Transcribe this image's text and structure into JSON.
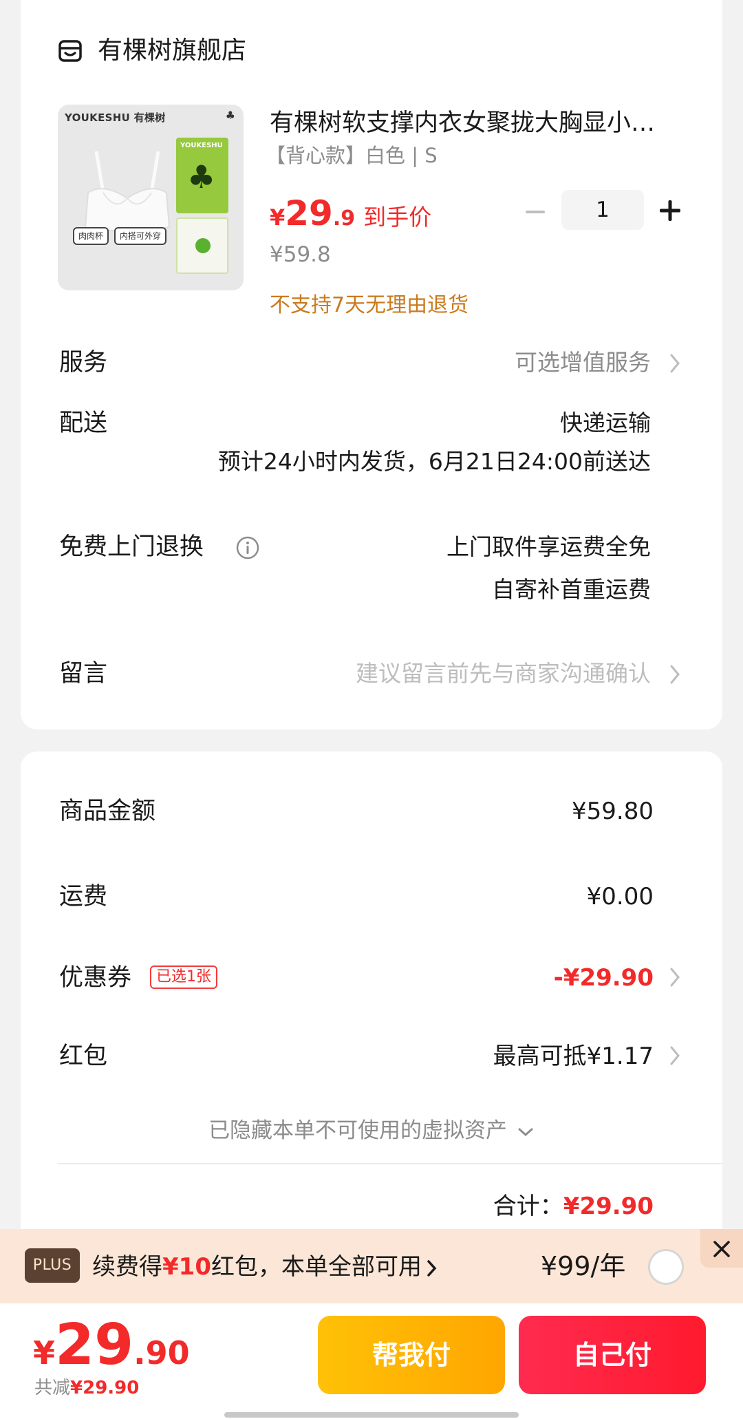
{
  "store": {
    "name": "有棵树旗舰店",
    "icon": "store-icon"
  },
  "product": {
    "image_brand": "YOUKESHU 有棵树",
    "image_box_brand": "YOUKESHU",
    "image_tag1": "肉肉杯",
    "image_tag2": "内搭可外穿",
    "title": "有棵树软支撑内衣女聚拢大胸显小文胸无钢圈",
    "spec": "【背心款】白色 | S",
    "price_symbol": "¥",
    "price_int": "29",
    "price_dec": ".9",
    "price_label": "到手价",
    "original_price": "¥59.8",
    "return_note": "不支持7天无理由退货",
    "quantity": "1"
  },
  "rows": {
    "service_label": "服务",
    "service_value": "可选增值服务",
    "delivery_label": "配送",
    "delivery_method": "快递运输",
    "delivery_eta": "预计24小时内发货，6月21日24:00前送达",
    "free_return_label": "免费上门退换",
    "free_return_value1": "上门取件享运费全免",
    "free_return_value2": "自寄补首重运费",
    "message_label": "留言",
    "message_hint": "建议留言前先与商家沟通确认"
  },
  "summary": {
    "goods_label": "商品金额",
    "goods_value": "¥59.80",
    "shipping_label": "运费",
    "shipping_value": "¥0.00",
    "coupon_label": "优惠券",
    "coupon_badge": "已选1张",
    "coupon_value": "-¥29.90",
    "redpack_label": "红包",
    "redpack_value": "最高可抵¥1.17",
    "hidden_assets": "已隐藏本单不可使用的虚拟资产",
    "total_label": "合计：",
    "total_value": "¥29.90"
  },
  "plus": {
    "badge": "PLUS",
    "text_pre": "续费得",
    "text_highlight": "¥10",
    "text_post": "红包，本单全部可用",
    "price": "¥99/年"
  },
  "bottom": {
    "price_symbol": "¥",
    "price_int": "29",
    "price_dec": ".90",
    "saving_label": "共减",
    "saving_value": "¥29.90",
    "help_pay": "帮我付",
    "self_pay": "自己付"
  },
  "colors": {
    "accent_red": "#f22a2a",
    "orange_note": "#c97a1c",
    "help_pay_gradient": "#ffc107",
    "self_pay_gradient": "#ff2b4f"
  }
}
